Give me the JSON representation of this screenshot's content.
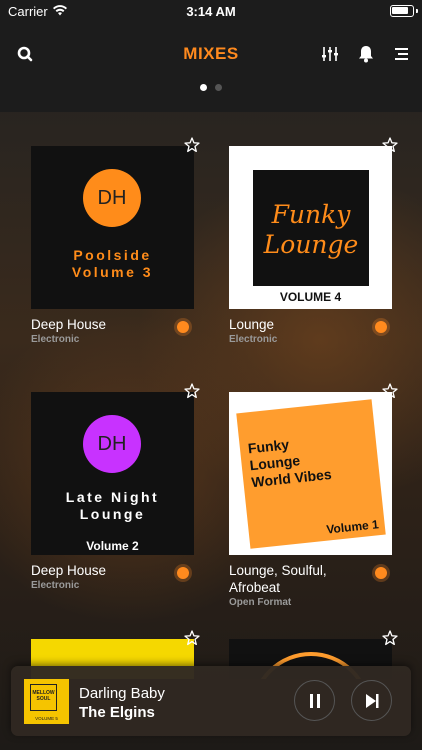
{
  "status_bar": {
    "carrier": "Carrier",
    "time": "3:14 AM"
  },
  "nav": {
    "title": "MIXES",
    "page_dots": 2,
    "active_dot": 0
  },
  "icons": {
    "search": "search-icon",
    "equalizer": "equalizer-icon",
    "notifications": "bell-icon",
    "menu": "menu-icon",
    "favorite": "star-outline-icon"
  },
  "colors": {
    "accent": "#ff8a1e",
    "background": "#1c1c1c"
  },
  "mixes": [
    {
      "title": "Deep House",
      "subtitle": "Electronic",
      "art": {
        "badge": "DH",
        "badge_color": "#ff8c1a",
        "lines": [
          "Poolside",
          "Volume 3"
        ],
        "text_color": "#ff8c1a"
      }
    },
    {
      "title": "Lounge",
      "subtitle": "Electronic",
      "art": {
        "script": [
          "Funky",
          "Lounge"
        ],
        "footer": "VOLUME 4"
      }
    },
    {
      "title": "Deep House",
      "subtitle": "Electronic",
      "art": {
        "badge": "DH",
        "badge_color": "#c832ff",
        "lines": [
          "Late Night",
          "Lounge"
        ],
        "footer": "Volume 2"
      }
    },
    {
      "title": "Lounge, Soulful, Afrobeat",
      "subtitle": "Open Format",
      "art": {
        "lines": [
          "Funky",
          "Lounge",
          "World Vibes"
        ],
        "footer": "Volume 1"
      }
    }
  ],
  "player": {
    "track": "Darling Baby",
    "artist": "The Elgins",
    "art_brand": "MELLOW SOUL",
    "art_volume": "VOLUME 5"
  }
}
